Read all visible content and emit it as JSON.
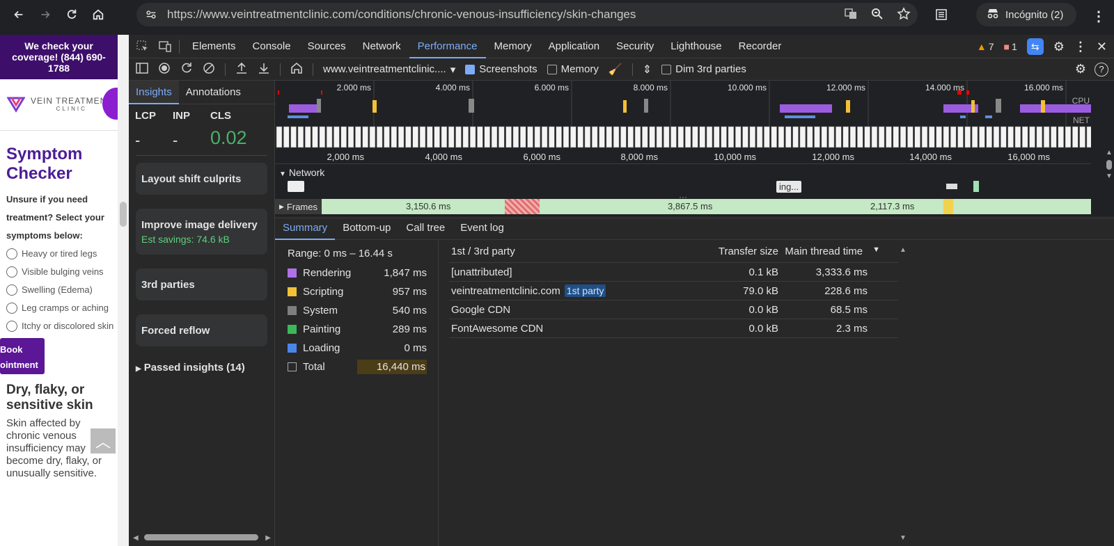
{
  "browser": {
    "url": "https://www.veintreatmentclinic.com/conditions/chronic-venous-insufficiency/skin-changes",
    "incognito_label": "Incógnito (2)"
  },
  "site": {
    "promo": "We check your coverage! (844) 690-1788",
    "logo_text": "VEIN TREATMENT",
    "logo_sub": "CLINIC",
    "heading": "Symptom Checker",
    "intro": "Unsure if you need treatment? Select your symptoms below:",
    "options": [
      "Heavy or tired legs",
      "Visible bulging veins",
      "Swelling (Edema)",
      "Leg cramps or aching",
      "Itchy or discolored skin"
    ],
    "book": "Book\nointment",
    "section_heading": "Dry, flaky, or sensitive skin",
    "paragraph": "Skin affected by chronic venous insufficiency may become dry, flaky, or unusually sensitive."
  },
  "devtools": {
    "tabs": [
      "Elements",
      "Console",
      "Sources",
      "Network",
      "Performance",
      "Memory",
      "Application",
      "Security",
      "Lighthouse",
      "Recorder"
    ],
    "active_tab": "Performance",
    "warnings": "7",
    "errors": "1",
    "toolbar": {
      "target": "www.veintreatmentclinic....",
      "screenshots": "Screenshots",
      "memory": "Memory",
      "dim": "Dim 3rd parties"
    },
    "insights_tabs": [
      "Insights",
      "Annotations"
    ],
    "metrics": [
      {
        "k": "LCP",
        "v": "-"
      },
      {
        "k": "INP",
        "v": "-"
      },
      {
        "k": "CLS",
        "v": "0.02"
      }
    ],
    "cards": [
      "Layout shift culprits",
      "Improve image delivery",
      "3rd parties",
      "Forced reflow"
    ],
    "image_savings": "Est savings: 74.6 kB",
    "passed": "Passed insights (14)",
    "overview_ticks": [
      "2.000 ms",
      "4.000 ms",
      "6.000 ms",
      "8.000 ms",
      "10.000 ms",
      "12.000 ms",
      "14.000 ms",
      "16.000 ms"
    ],
    "ruler_ticks": [
      "2,000 ms",
      "4,000 ms",
      "6,000 ms",
      "8,000 ms",
      "10,000 ms",
      "12,000 ms",
      "14,000 ms",
      "16,000 ms"
    ],
    "cpu": "CPU",
    "net": "NET",
    "network_label": "Network",
    "network_chip": "ing...",
    "frames_label": "Frames",
    "frames": [
      "3,150.6 ms",
      "3,867.5 ms",
      "2,117.3 ms"
    ],
    "bottom_tabs": [
      "Summary",
      "Bottom-up",
      "Call tree",
      "Event log"
    ],
    "range": "Range: 0 ms – 16.44 s",
    "summary": [
      {
        "label": "Rendering",
        "value": "1,847 ms",
        "color": "#b070e8"
      },
      {
        "label": "Scripting",
        "value": "957 ms",
        "color": "#f2c037"
      },
      {
        "label": "System",
        "value": "540 ms",
        "color": "#7f7f7f"
      },
      {
        "label": "Painting",
        "value": "289 ms",
        "color": "#3cb75a"
      },
      {
        "label": "Loading",
        "value": "0 ms",
        "color": "#4a86e8"
      },
      {
        "label": "Total",
        "value": "16,440 ms",
        "color": ""
      }
    ],
    "table": {
      "headers": [
        "1st / 3rd party",
        "Transfer size",
        "Main thread time"
      ],
      "rows": [
        {
          "name": "[unattributed]",
          "badge": "",
          "size": "0.1 kB",
          "time": "3,333.6 ms"
        },
        {
          "name": "veintreatmentclinic.com",
          "badge": "1st party",
          "size": "79.0 kB",
          "time": "228.6 ms"
        },
        {
          "name": "Google CDN",
          "badge": "",
          "size": "0.0 kB",
          "time": "68.5 ms"
        },
        {
          "name": "FontAwesome CDN",
          "badge": "",
          "size": "0.0 kB",
          "time": "2.3 ms"
        }
      ]
    }
  }
}
